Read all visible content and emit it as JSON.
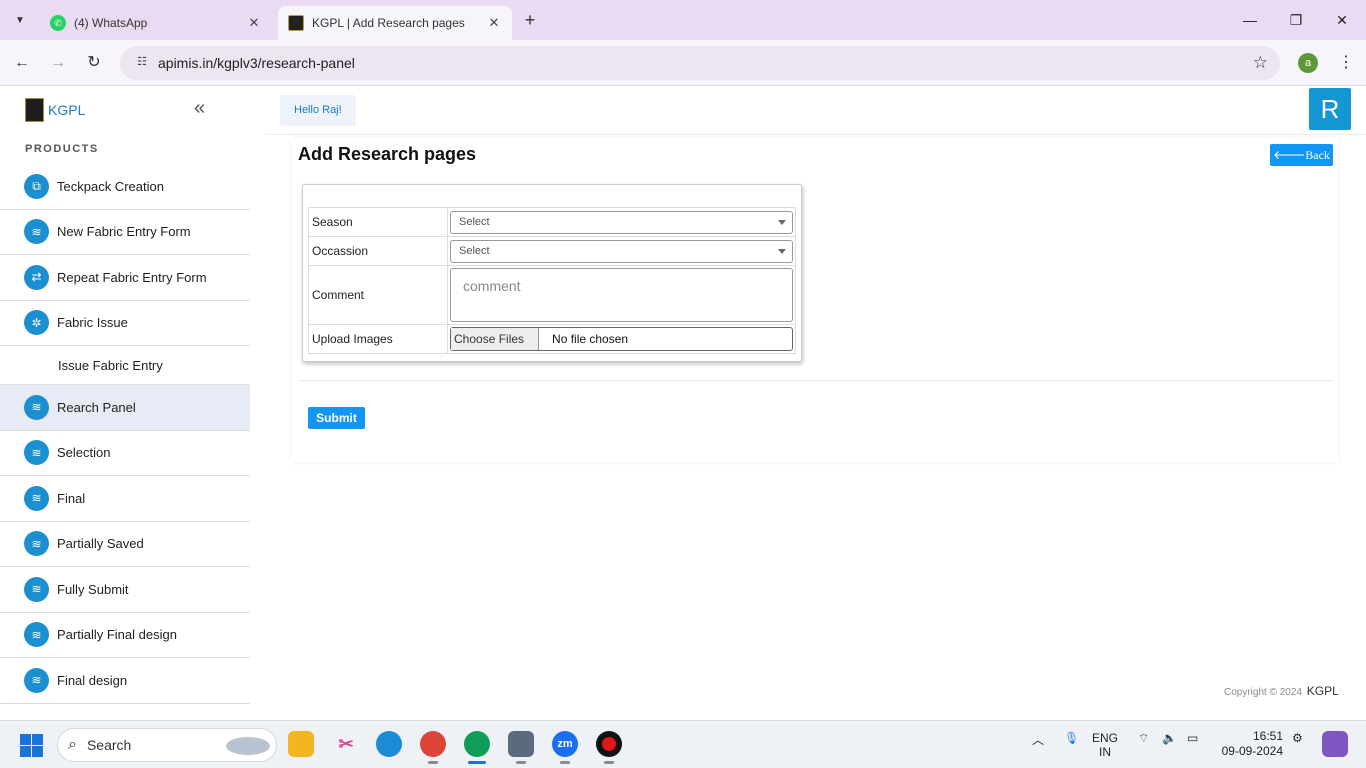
{
  "browser": {
    "tabs": [
      {
        "title": "(4) WhatsApp",
        "icon": "whatsapp-icon",
        "active": false
      },
      {
        "title": "KGPL | Add Research pages",
        "icon": "kgpl-logo-icon",
        "active": true
      }
    ],
    "url": "apimis.in/kgplv3/research-panel",
    "profile_initial": "a"
  },
  "sidebar": {
    "brand": "KGPL",
    "section_label": "PRODUCTS",
    "items": [
      {
        "label": "Teckpack Creation",
        "icon": "techpack-icon",
        "active": false,
        "sub": false
      },
      {
        "label": "New Fabric Entry Form",
        "icon": "fabric-icon",
        "active": false,
        "sub": false
      },
      {
        "label": "Repeat Fabric Entry Form",
        "icon": "repeat-icon",
        "active": false,
        "sub": false
      },
      {
        "label": "Fabric Issue",
        "icon": "fabric-issue-icon",
        "active": false,
        "sub": false
      },
      {
        "label": "Issue Fabric Entry",
        "icon": "",
        "active": false,
        "sub": true
      },
      {
        "label": "Rearch Panel",
        "icon": "fabric-icon",
        "active": true,
        "sub": false
      },
      {
        "label": "Selection",
        "icon": "fabric-icon",
        "active": false,
        "sub": false
      },
      {
        "label": "Final",
        "icon": "fabric-icon",
        "active": false,
        "sub": false
      },
      {
        "label": "Partially Saved",
        "icon": "fabric-icon",
        "active": false,
        "sub": false
      },
      {
        "label": "Fully Submit",
        "icon": "fabric-icon",
        "active": false,
        "sub": false
      },
      {
        "label": "Partially Final design",
        "icon": "fabric-icon",
        "active": false,
        "sub": false
      },
      {
        "label": "Final design",
        "icon": "fabric-icon",
        "active": false,
        "sub": false
      }
    ]
  },
  "header": {
    "greeting": "Hello Raj!",
    "avatar_initial": "R"
  },
  "main": {
    "title": "Add Research pages",
    "back_label": "Back",
    "form": {
      "season_label": "Season",
      "season_value": "Select",
      "occasion_label": "Occassion",
      "occasion_value": "Select",
      "comment_label": "Comment",
      "comment_placeholder": "comment",
      "upload_label": "Upload Images",
      "choose_files_label": "Choose Files",
      "no_file_text": "No file chosen"
    },
    "submit_label": "Submit"
  },
  "footer": {
    "copyright": "Copyright © 2024",
    "brand": "KGPL"
  },
  "taskbar": {
    "search_placeholder": "Search",
    "lang_line1": "ENG",
    "lang_line2": "IN",
    "time": "16:51",
    "date": "09-09-2024"
  },
  "colors": {
    "accent": "#1296f3",
    "sidebar_icon": "#1b8fd0",
    "active_item_bg": "#e6ebf5",
    "avatar_bg": "#1296d4"
  }
}
